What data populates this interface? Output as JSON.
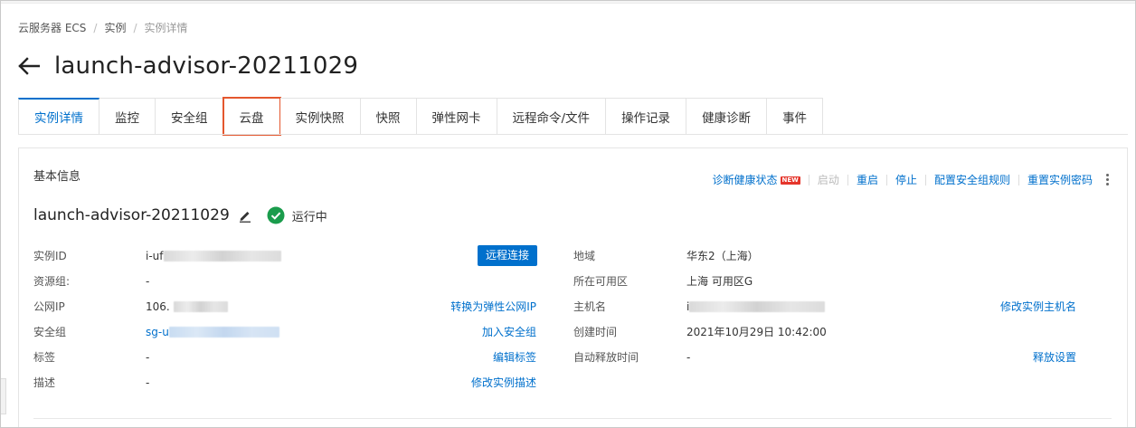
{
  "breadcrumb": {
    "items": [
      "云服务器 ECS",
      "实例",
      "实例详情"
    ],
    "separator": "/"
  },
  "page": {
    "title": "launch-advisor-20211029",
    "back_icon": "arrow-left-icon"
  },
  "tabs": [
    {
      "label": "实例详情",
      "active": true
    },
    {
      "label": "监控"
    },
    {
      "label": "安全组"
    },
    {
      "label": "云盘",
      "highlighted": true
    },
    {
      "label": "实例快照"
    },
    {
      "label": "快照"
    },
    {
      "label": "弹性网卡"
    },
    {
      "label": "远程命令/文件"
    },
    {
      "label": "操作记录"
    },
    {
      "label": "健康诊断"
    },
    {
      "label": "事件"
    }
  ],
  "basic_info": {
    "section_title": "基本信息",
    "actions": {
      "diagnose": "诊断健康状态",
      "new_badge": "NEW",
      "start": "启动",
      "restart": "重启",
      "stop": "停止",
      "config_sg_rules": "配置安全组规则",
      "reset_password": "重置实例密码"
    },
    "instance_name": "launch-advisor-20211029",
    "status": "运行中",
    "left_fields": {
      "instance_id": {
        "label": "实例ID",
        "value": "i-uf"
      },
      "resource_group": {
        "label": "资源组:",
        "value": "-"
      },
      "public_ip": {
        "label": "公网IP",
        "value": "106."
      },
      "security_group": {
        "label": "安全组",
        "value": "sg-u"
      },
      "tags": {
        "label": "标签",
        "value": "-"
      },
      "description": {
        "label": "描述",
        "value": "-"
      }
    },
    "left_actions": {
      "remote_connect": "远程连接",
      "convert_eip": "转换为弹性公网IP",
      "join_sg": "加入安全组",
      "edit_tags": "编辑标签",
      "edit_description": "修改实例描述"
    },
    "right_fields": {
      "region": {
        "label": "地域",
        "value": "华东2（上海）"
      },
      "zone": {
        "label": "所在可用区",
        "value": "上海 可用区G"
      },
      "hostname": {
        "label": "主机名",
        "value": "i"
      },
      "created": {
        "label": "创建时间",
        "value": "2021年10月29日 10:42:00"
      },
      "auto_release": {
        "label": "自动释放时间",
        "value": "-"
      }
    },
    "right_actions": {
      "edit_hostname": "修改实例主机名",
      "release_settings": "释放设置"
    }
  },
  "colors": {
    "accent": "#0070cc",
    "highlight_box": "#e4572e",
    "status_ok": "#1a9c4c",
    "new_badge": "#e5352b"
  }
}
